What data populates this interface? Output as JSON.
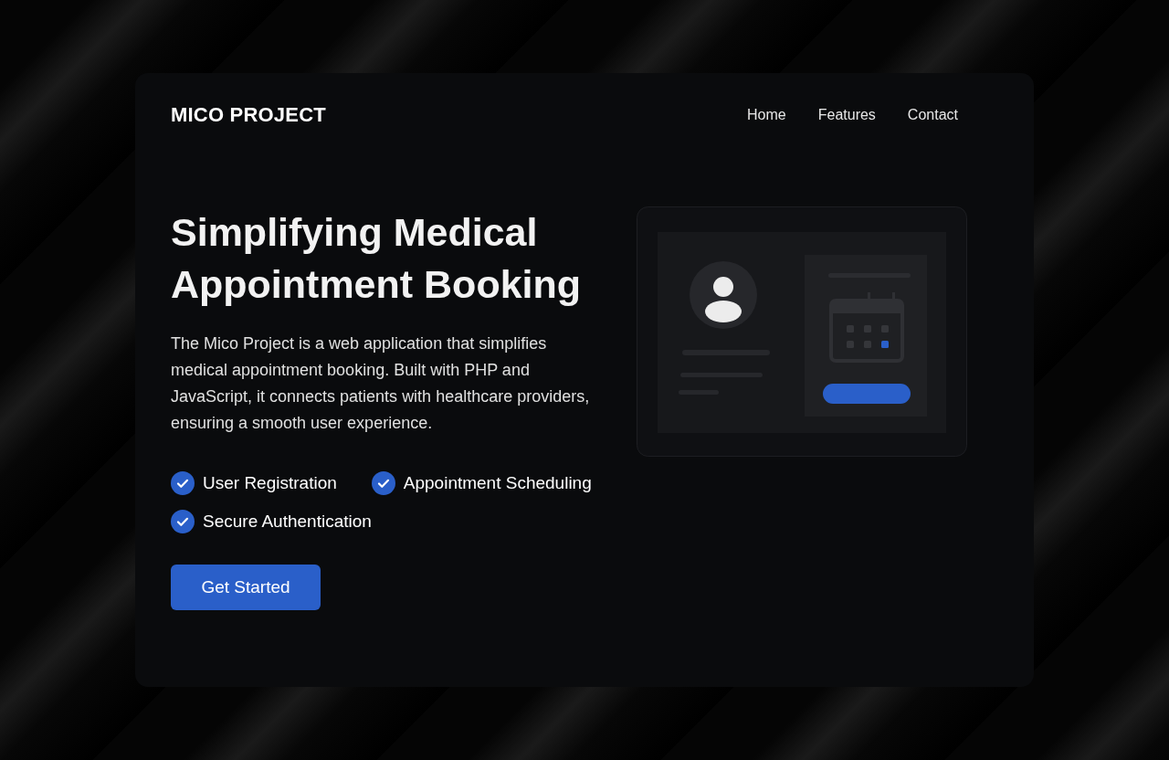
{
  "brand": "MICO PROJECT",
  "nav": [
    {
      "label": "Home"
    },
    {
      "label": "Features"
    },
    {
      "label": "Contact"
    }
  ],
  "hero": {
    "title": "Simplifying Medical Appointment Booking",
    "description": "The Mico Project is a web application that simplifies medical appointment booking. Built with PHP and JavaScript, it connects patients with healthcare providers, ensuring a smooth user experience.",
    "features": [
      {
        "label": "User Registration"
      },
      {
        "label": "Appointment Scheduling"
      },
      {
        "label": "Secure Authentication"
      }
    ],
    "button": "Get Started"
  }
}
